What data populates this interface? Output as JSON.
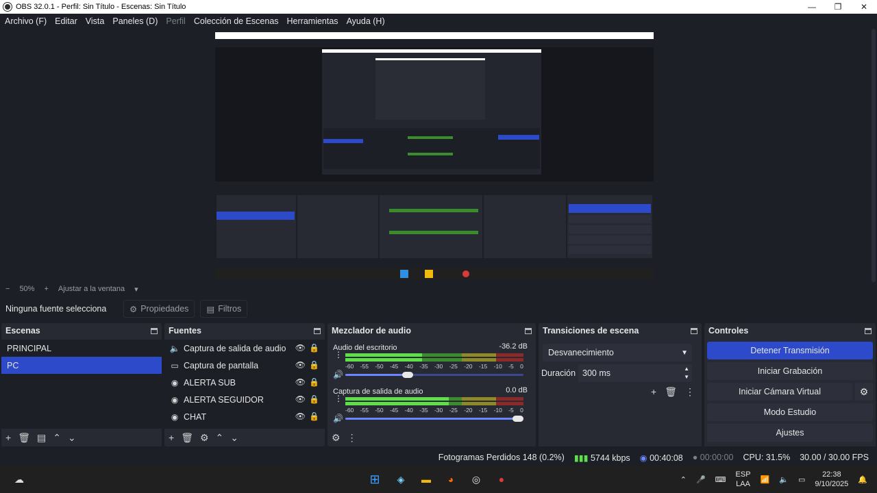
{
  "window": {
    "title": "OBS 32.0.1 - Perfil: Sin Título - Escenas: Sin Título"
  },
  "menu": [
    "Archivo (F)",
    "Editar",
    "Vista",
    "Paneles (D)",
    "Perfil",
    "Colección de Escenas",
    "Herramientas",
    "Ayuda (H)"
  ],
  "zoom": {
    "minus": "−",
    "value": "50%",
    "plus": "+",
    "fit": "Ajustar a la ventana"
  },
  "context": {
    "no_source": "Ninguna fuente selecciona",
    "properties": "Propiedades",
    "filters": "Filtros"
  },
  "scenes": {
    "title": "Escenas",
    "items": [
      "PRINCIPAL",
      "PC"
    ],
    "selected": "PC"
  },
  "sources": {
    "title": "Fuentes",
    "items": [
      {
        "name": "Captura de salida de audio",
        "icon": "speaker-icon"
      },
      {
        "name": "Captura de pantalla",
        "icon": "monitor-icon"
      },
      {
        "name": "ALERTA SUB",
        "icon": "globe-icon"
      },
      {
        "name": "ALERTA SEGUIDOR",
        "icon": "globe-icon"
      },
      {
        "name": "CHAT",
        "icon": "globe-icon"
      }
    ]
  },
  "mixer": {
    "title": "Mezclador de audio",
    "ticks": [
      "-60",
      "-55",
      "-50",
      "-45",
      "-40",
      "-35",
      "-30",
      "-25",
      "-20",
      "-15",
      "-10",
      "-5",
      "0"
    ],
    "channels": [
      {
        "name": "Audio del escritorio",
        "db": "-36.2 dB",
        "level": 0.43,
        "volume": 0.32
      },
      {
        "name": "Captura de salida de audio",
        "db": "0.0 dB",
        "level": 0.58,
        "volume": 1.0
      }
    ]
  },
  "transitions": {
    "title": "Transiciones de escena",
    "selected": "Desvanecimiento",
    "duration_label": "Duración",
    "duration_value": "300 ms"
  },
  "controls": {
    "title": "Controles",
    "stop_stream": "Detener Transmisión",
    "start_record": "Iniciar Grabación",
    "start_vcam": "Iniciar Cámara Virtual",
    "studio_mode": "Modo Estudio",
    "settings": "Ajustes"
  },
  "status": {
    "dropped": "Fotogramas Perdidos 148 (0.2%)",
    "bitrate": "5744 kbps",
    "stream_time": "00:40:08",
    "rec_time": "00:00:00",
    "cpu": "CPU: 31.5%",
    "fps": "30.00 / 30.00 FPS"
  },
  "taskbar": {
    "lang_top": "ESP",
    "lang_bottom": "LAA",
    "time": "22:38",
    "date": "9/10/2025"
  },
  "colors": {
    "accent": "#2c4ac9",
    "background": "#1d1f26",
    "dock": "#272a33",
    "meter_green": "#5fe04a"
  }
}
